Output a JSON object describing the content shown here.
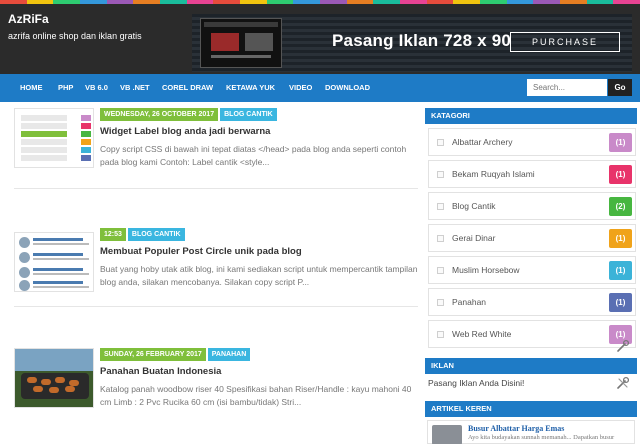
{
  "header": {
    "site_title": "AzRiFa",
    "tagline": "azrifa online shop dan iklan gratis",
    "banner_text": "Pasang Iklan 728 x 90",
    "banner_button": "PURCHASE"
  },
  "colors": {
    "rainbow": [
      "#e74c3c",
      "#f1c40f",
      "#2ecc71",
      "#3498db",
      "#9b59b6",
      "#e67e22",
      "#1abc9c",
      "#e84393"
    ],
    "nav_bg": "#1e7bc6",
    "header_bg": "#2b2b2b",
    "date_badge": "#7fbf3b",
    "category_badge": "#3ab6e0"
  },
  "nav": {
    "items": [
      "HOME",
      "PHP",
      "VB 6.0",
      "VB .NET",
      "COREL DRAW",
      "KETAWA YUK",
      "VIDEO",
      "DOWNLOAD"
    ],
    "search_placeholder": "Search...",
    "search_button": "Go"
  },
  "posts": [
    {
      "date": "WEDNESDAY, 26 OCTOBER 2017",
      "category": "BLOG CANTIK",
      "title": "Widget Label blog anda jadi berwarna",
      "snippet": "Copy script CSS di bawah ini tepat diatas </head> pada blog anda seperti contoh pada blog kami Contoh: Label cantik <style..."
    },
    {
      "date": "12:53",
      "category": "BLOG CANTIK",
      "title": "Membuat Populer Post Circle unik pada blog",
      "snippet": "Buat yang hoby utak atik blog, ini kami sediakan script untuk mempercantik tampilan blog anda, silakan mencobanya. Silakan copy script P..."
    },
    {
      "date": "SUNDAY, 26 FEBRUARY 2017",
      "category": "PANAHAN",
      "title": "Panahan Buatan Indonesia",
      "snippet": "Katalog panah woodbow riser 40 Spesifikasi bahan Riser/Handle : kayu mahoni 40 cm Limb    : 2 Pvc Rucika 60 cm (isi bambu/tidak) Stri..."
    }
  ],
  "sidebar": {
    "kategori_title": "KATAGORI",
    "categories": [
      {
        "label": "Albattar Archery",
        "count": "(1)",
        "color": "#c98ac9"
      },
      {
        "label": "Bekam Ruqyah Islami",
        "count": "(1)",
        "color": "#e8336a"
      },
      {
        "label": "Blog Cantik",
        "count": "(2)",
        "color": "#47b640"
      },
      {
        "label": "Gerai Dinar",
        "count": "(1)",
        "color": "#f0a31a"
      },
      {
        "label": "Muslim Horsebow",
        "count": "(1)",
        "color": "#3bb3d8"
      },
      {
        "label": "Panahan",
        "count": "(1)",
        "color": "#5a6fb3"
      },
      {
        "label": "Web Red White",
        "count": "(1)",
        "color": "#c98ac9"
      }
    ],
    "iklan_title": "IKLAN",
    "iklan_text": "Pasang Iklan Anda Disini!",
    "artikel_title": "ARTIKEL KEREN",
    "artikel": {
      "title": "Busur Albattar Harga Emas",
      "snippet": "Ayo kita budayakan sunnah memanah... Dapatkan busur"
    }
  }
}
